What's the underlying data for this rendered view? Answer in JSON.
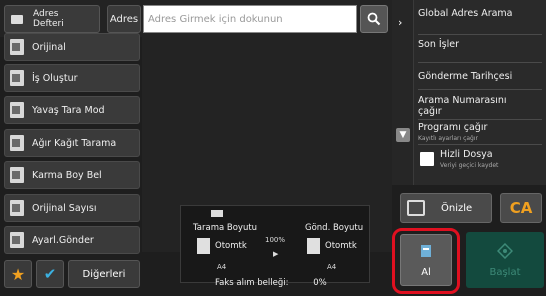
{
  "top_bar": {
    "address_book_label": "Adres Defteri",
    "address_button_label": "Adres",
    "address_input_placeholder": "Adres Girmek için dokunun"
  },
  "modes": [
    {
      "label": "Orijinal",
      "icon": "original-doc-icon"
    },
    {
      "label": "İş Oluştur",
      "icon": "job-build-icon"
    },
    {
      "label": "Yavaş Tara Mod",
      "icon": "slow-scan-icon"
    },
    {
      "label": "Ağır Kağıt Tarama",
      "icon": "heavy-paper-icon"
    },
    {
      "label": "Karma Boy Bel",
      "icon": "mixed-size-icon"
    },
    {
      "label": "Orijinal Sayısı",
      "icon": "original-count-icon"
    },
    {
      "label": "Ayarl.Gönder",
      "icon": "send-settings-icon"
    }
  ],
  "bottom_left": {
    "others_label": "Diğerleri"
  },
  "right_menu": {
    "global_address_search": "Global Adres Arama",
    "recent_jobs": "Son İşler",
    "send_history": "Gönderme Tarihçesi",
    "call_number": "Arama Numarasını çağır",
    "call_program": "Programı çağır",
    "call_program_sub": "Kayıtlı ayarları çağır",
    "quick_file": "Hizli Dosya",
    "quick_file_sub": "Veriyi geçici kaydet"
  },
  "actions": {
    "preview_label": "Önizle",
    "ca_label": "CA",
    "receive_label": "Al",
    "start_label": "Başlat"
  },
  "status": {
    "scan_size_label": "Tarama Boyutu",
    "scan_size_value": "Otomtk",
    "scan_paper": "A4",
    "zoom": "100%",
    "send_size_label": "Gönd. Boyutu",
    "send_size_value": "Otomtk",
    "send_paper": "A4",
    "fax_memory_label": "Faks alım belleği:",
    "fax_memory_value": "0%"
  },
  "colors": {
    "highlight": "#e01020",
    "accent_orange": "#f0a020",
    "start_green": "#134a3e"
  }
}
